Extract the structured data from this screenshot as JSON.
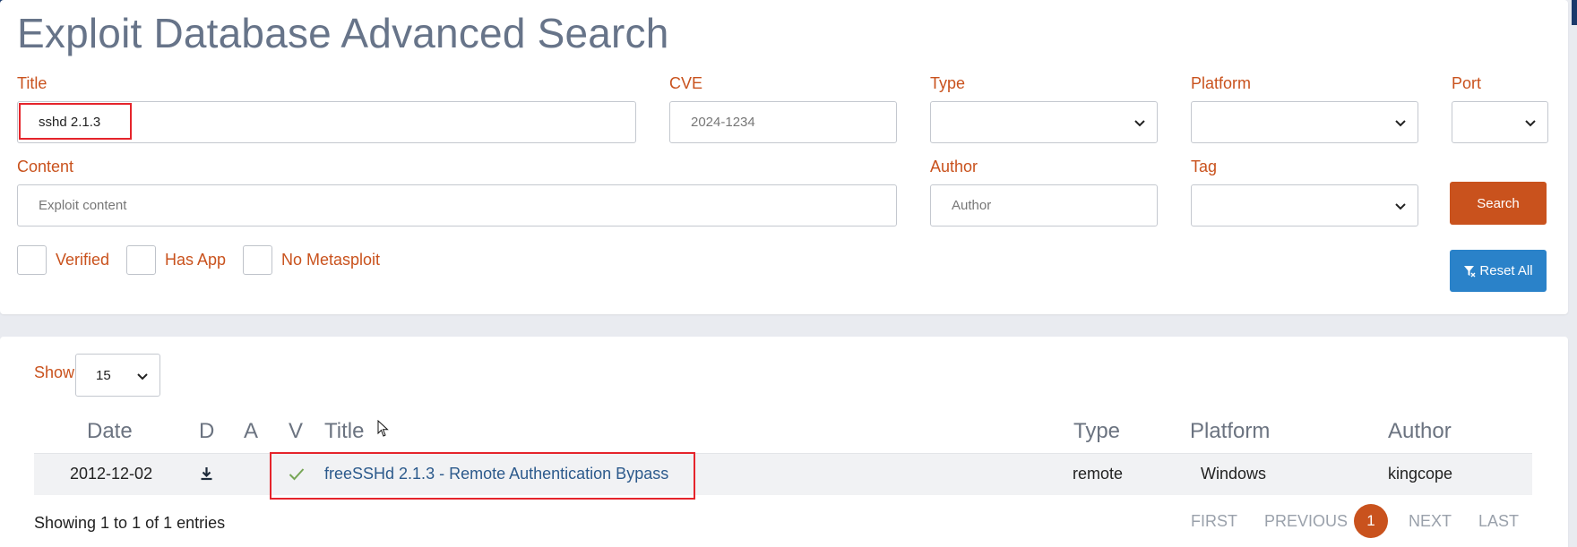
{
  "page": {
    "title": "Exploit Database Advanced Search"
  },
  "filters": {
    "title_label": "Title",
    "title_value": "sshd 2.1.3",
    "cve_label": "CVE",
    "cve_placeholder": "2024-1234",
    "type_label": "Type",
    "platform_label": "Platform",
    "port_label": "Port",
    "content_label": "Content",
    "content_placeholder": "Exploit content",
    "author_label": "Author",
    "author_placeholder": "Author",
    "tag_label": "Tag",
    "checkboxes": {
      "verified": "Verified",
      "has_app": "Has App",
      "no_metasploit": "No Metasploit"
    },
    "search_button": "Search",
    "reset_button": "Reset All"
  },
  "results": {
    "show_label": "Show",
    "page_size": "15",
    "columns": {
      "date": "Date",
      "d": "D",
      "a": "A",
      "v": "V",
      "title": "Title",
      "type": "Type",
      "platform": "Platform",
      "author": "Author"
    },
    "rows": [
      {
        "date": "2012-12-02",
        "download_icon": "download-icon",
        "verified_icon": "check-icon",
        "title": "freeSSHd 2.1.3 - Remote Authentication Bypass",
        "type": "remote",
        "platform": "Windows",
        "author": "kingcope"
      }
    ],
    "info": "Showing 1 to 1 of 1 entries",
    "pagination": {
      "first": "FIRST",
      "previous": "PREVIOUS",
      "current": "1",
      "next": "NEXT",
      "last": "LAST"
    }
  },
  "colors": {
    "accent_orange": "#c9521d",
    "accent_blue": "#2a82c9",
    "link_blue": "#2c5a8c",
    "highlight_red": "#e5242b"
  }
}
